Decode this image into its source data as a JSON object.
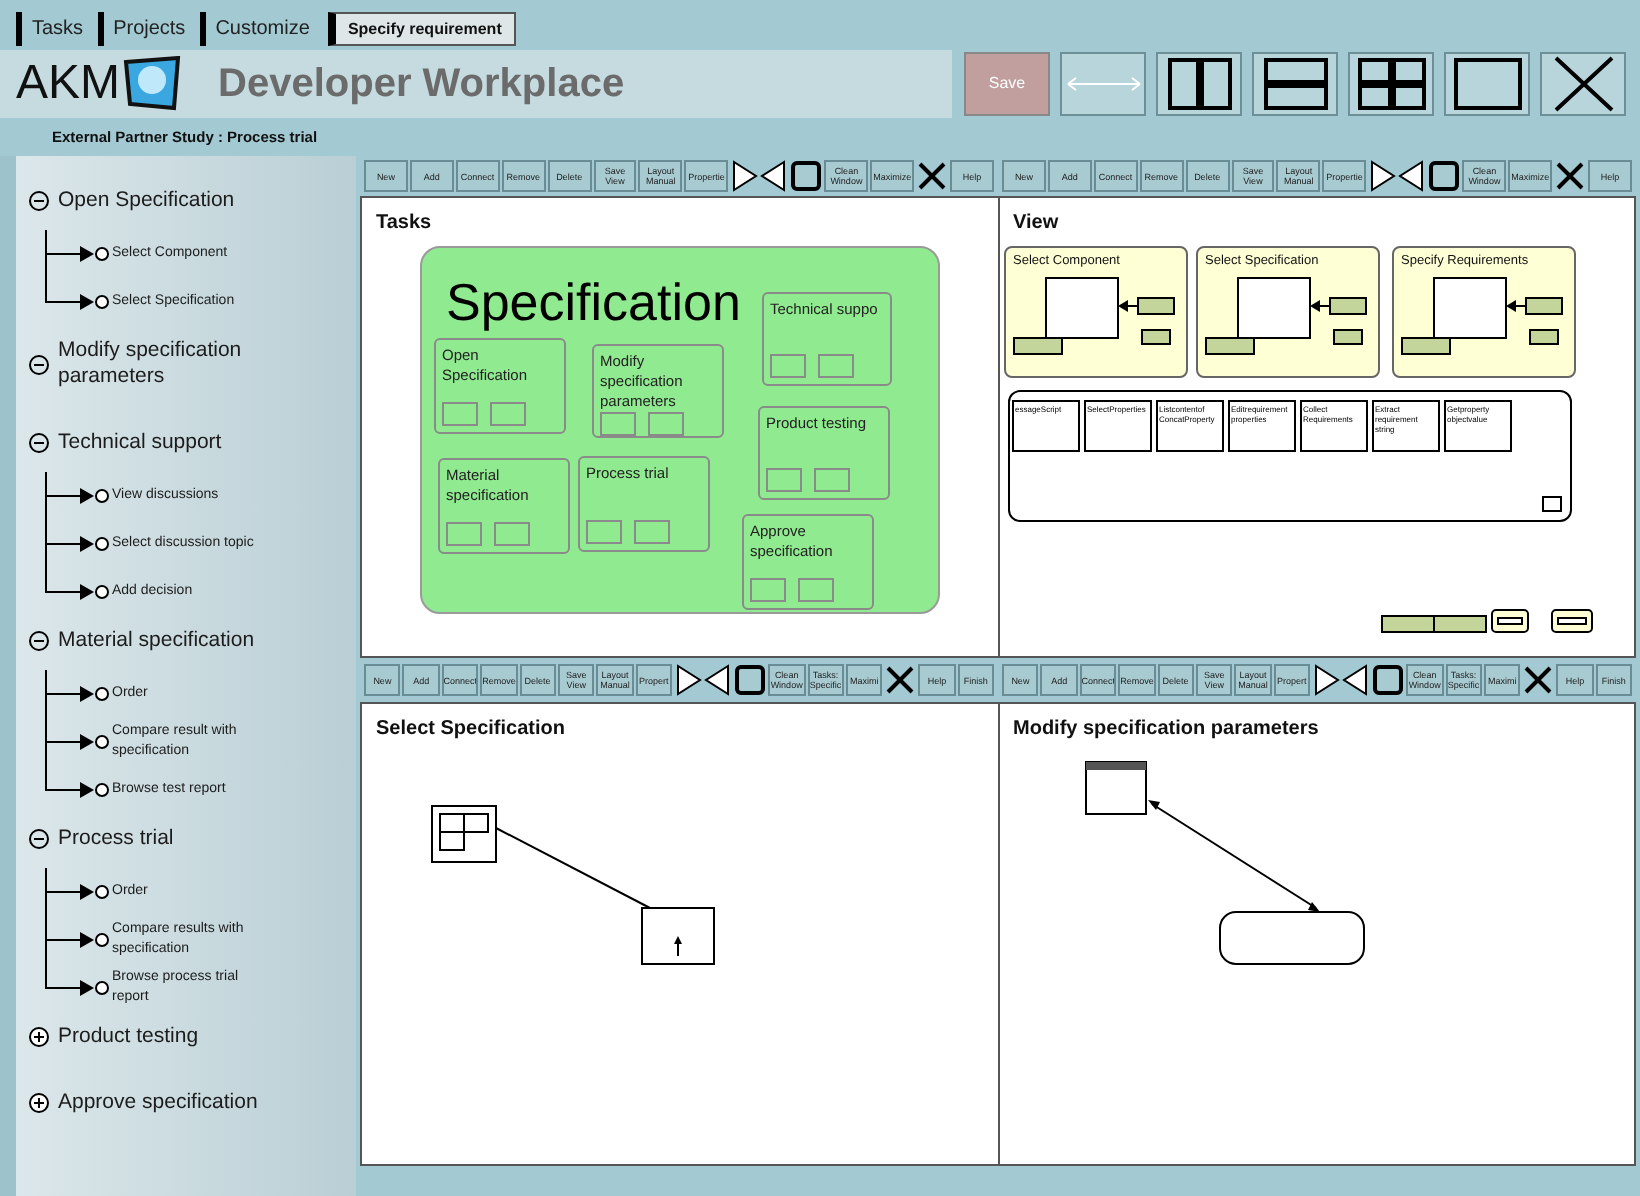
{
  "tabs": [
    {
      "label": "Tasks",
      "selected": false
    },
    {
      "label": "Projects",
      "selected": false
    },
    {
      "label": "Customize",
      "selected": false
    },
    {
      "label": "Specify requirement",
      "selected": true
    }
  ],
  "header": {
    "logo": "AKM",
    "title": "Developer Workplace",
    "save_button": "Save",
    "layout_buttons": [
      {
        "kind": "swap"
      },
      {
        "kind": "columns"
      },
      {
        "kind": "rows"
      },
      {
        "kind": "grid"
      },
      {
        "kind": "single"
      },
      {
        "kind": "close"
      }
    ]
  },
  "breadcrumb": "External Partner Study : Process trial",
  "sidebar": {
    "groups": [
      {
        "label": "Open Specification",
        "expanded": true,
        "children": [
          {
            "label": "Select Component"
          },
          {
            "label": "Select Specification"
          }
        ]
      },
      {
        "label": "Modify specification parameters",
        "expanded": true
      },
      {
        "label": "Technical support",
        "expanded": true,
        "children": [
          {
            "label": "View discussions"
          },
          {
            "label": "Select discussion topic"
          },
          {
            "label": "Add decision"
          }
        ]
      },
      {
        "label": "Material specification",
        "expanded": true,
        "children": [
          {
            "label": "Order"
          },
          {
            "label": "Compare result with specification"
          },
          {
            "label": "Browse test report"
          }
        ]
      },
      {
        "label": "Process trial",
        "expanded": true,
        "children": [
          {
            "label": "Order"
          },
          {
            "label": "Compare results with specification"
          },
          {
            "label": "Browse process trial report"
          }
        ]
      },
      {
        "label": "Product testing",
        "expanded": false
      },
      {
        "label": "Approve specification",
        "expanded": false
      }
    ]
  },
  "panels": [
    {
      "kind": "tasks",
      "title": "Tasks",
      "container_title": "Specification",
      "toolbar": [
        {
          "kind": "text",
          "label": "New"
        },
        {
          "kind": "text",
          "label": "Add"
        },
        {
          "kind": "text",
          "label": "Connect"
        },
        {
          "kind": "text",
          "label": "Remove"
        },
        {
          "kind": "text",
          "label": "Delete"
        },
        {
          "kind": "text",
          "label": "Save View"
        },
        {
          "kind": "text",
          "label": "Layout Manual"
        },
        {
          "kind": "text",
          "label": "Propertie"
        },
        {
          "kind": "next"
        },
        {
          "kind": "prev"
        },
        {
          "kind": "window"
        },
        {
          "kind": "text",
          "label": "Clean Window"
        },
        {
          "kind": "text",
          "label": "Maximize"
        },
        {
          "kind": "close"
        },
        {
          "kind": "text",
          "label": "Help"
        }
      ],
      "nodes": [
        {
          "label": "Open Specification"
        },
        {
          "label": "Modify specification parameters"
        },
        {
          "label": "Technical suppo"
        },
        {
          "label": "Product testing"
        },
        {
          "label": "Material specification"
        },
        {
          "label": "Process trial"
        },
        {
          "label": "Approve specification"
        }
      ]
    },
    {
      "kind": "view",
      "title": "View",
      "toolbar": [
        {
          "kind": "text",
          "label": "New"
        },
        {
          "kind": "text",
          "label": "Add"
        },
        {
          "kind": "text",
          "label": "Connect"
        },
        {
          "kind": "text",
          "label": "Remove"
        },
        {
          "kind": "text",
          "label": "Delete"
        },
        {
          "kind": "text",
          "label": "Save View"
        },
        {
          "kind": "text",
          "label": "Layout Manual"
        },
        {
          "kind": "text",
          "label": "Propertie"
        },
        {
          "kind": "next"
        },
        {
          "kind": "prev"
        },
        {
          "kind": "window"
        },
        {
          "kind": "text",
          "label": "Clean Window"
        },
        {
          "kind": "text",
          "label": "Maximize"
        },
        {
          "kind": "close"
        },
        {
          "kind": "text",
          "label": "Help"
        }
      ],
      "views": [
        {
          "title": "Select Component"
        },
        {
          "title": "Select Specification"
        },
        {
          "title": "Specify Requirements"
        }
      ],
      "operations": [
        {
          "label": "essageScript"
        },
        {
          "label": "SelectProperties"
        },
        {
          "label": "Listcontentof ConcatProperty"
        },
        {
          "label": "Editrequirement properties"
        },
        {
          "label": "Collect Requirements"
        },
        {
          "label": "Extract requirement string"
        },
        {
          "label": "Getproperty objectvalue"
        }
      ]
    },
    {
      "kind": "table_link",
      "title": "Select Specification",
      "toolbar": [
        {
          "kind": "text",
          "label": "New"
        },
        {
          "kind": "text",
          "label": "Add"
        },
        {
          "kind": "text",
          "label": "Connect"
        },
        {
          "kind": "text",
          "label": "Remove"
        },
        {
          "kind": "text",
          "label": "Delete"
        },
        {
          "kind": "text",
          "label": "Save View"
        },
        {
          "kind": "text",
          "label": "Layout Manual"
        },
        {
          "kind": "text",
          "label": "Propert"
        },
        {
          "kind": "next"
        },
        {
          "kind": "prev"
        },
        {
          "kind": "window"
        },
        {
          "kind": "text",
          "label": "Clean Window"
        },
        {
          "kind": "text",
          "label": "Tasks: Specific"
        },
        {
          "kind": "text",
          "label": "Maximi"
        },
        {
          "kind": "close"
        },
        {
          "kind": "text",
          "label": "Help"
        },
        {
          "kind": "text",
          "label": "Finish"
        }
      ]
    },
    {
      "kind": "table_round",
      "title": "Modify specification parameters",
      "toolbar": [
        {
          "kind": "text",
          "label": "New"
        },
        {
          "kind": "text",
          "label": "Add"
        },
        {
          "kind": "text",
          "label": "Connect"
        },
        {
          "kind": "text",
          "label": "Remove"
        },
        {
          "kind": "text",
          "label": "Delete"
        },
        {
          "kind": "text",
          "label": "Save View"
        },
        {
          "kind": "text",
          "label": "Layout Manual"
        },
        {
          "kind": "text",
          "label": "Propert"
        },
        {
          "kind": "next"
        },
        {
          "kind": "prev"
        },
        {
          "kind": "window"
        },
        {
          "kind": "text",
          "label": "Clean Window"
        },
        {
          "kind": "text",
          "label": "Tasks: Specific"
        },
        {
          "kind": "text",
          "label": "Maximi"
        },
        {
          "kind": "close"
        },
        {
          "kind": "text",
          "label": "Help"
        },
        {
          "kind": "text",
          "label": "Finish"
        }
      ]
    }
  ]
}
